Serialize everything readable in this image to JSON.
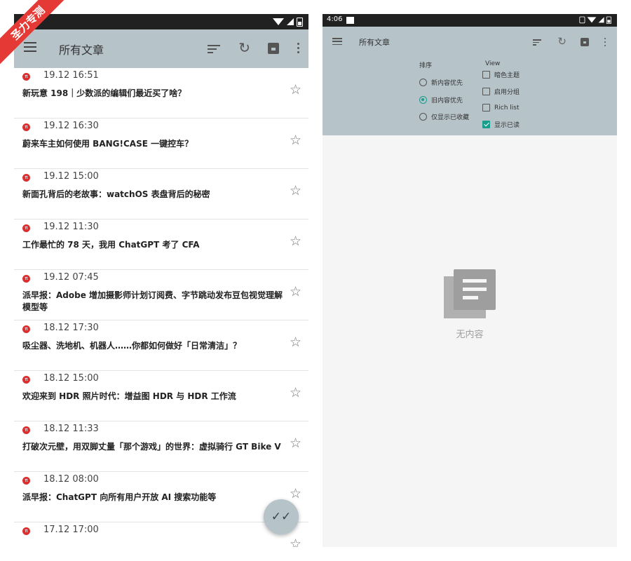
{
  "watermark": "圣力专测",
  "left": {
    "title": "所有文章",
    "articles": [
      {
        "time": "19.12 16:51",
        "title": "新玩意 198｜少数派的编辑们最近买了啥？"
      },
      {
        "time": "19.12 16:30",
        "title": "蔚来车主如何使用 BANG!CASE 一键控车？"
      },
      {
        "time": "19.12 15:00",
        "title": "新面孔背后的老故事：watchOS 表盘背后的秘密"
      },
      {
        "time": "19.12 11:30",
        "title": "工作最忙的 78 天，我用 ChatGPT 考了 CFA"
      },
      {
        "time": "19.12 07:45",
        "title": "派早报：Adobe 增加摄影师计划订阅费、字节跳动发布豆包视觉理解模型等"
      },
      {
        "time": "18.12 17:30",
        "title": "吸尘器、洗地机、机器人……你都如何做好「日常清洁」？"
      },
      {
        "time": "18.12 15:00",
        "title": "欢迎来到 HDR 照片时代：增益图 HDR 与 HDR 工作流"
      },
      {
        "time": "18.12 11:33",
        "title": "打破次元壁，用双脚丈量「那个游戏」的世界：虚拟骑行 GT Bike V"
      },
      {
        "time": "18.12 08:00",
        "title": "派早报：ChatGPT 向所有用户开放 AI 搜索功能等"
      },
      {
        "time": "17.12 17:00",
        "title": ""
      }
    ]
  },
  "right": {
    "status_time": "4:06",
    "title": "所有文章",
    "sort_header": "排序",
    "view_header": "View",
    "sort_options": [
      {
        "label": "新内容优先",
        "selected": false
      },
      {
        "label": "旧内容优先",
        "selected": true
      },
      {
        "label": "仅显示已收藏",
        "selected": false
      }
    ],
    "view_options": [
      {
        "label": "暗色主题",
        "checked": false
      },
      {
        "label": "启用分组",
        "checked": false
      },
      {
        "label": "Rich list",
        "checked": false
      },
      {
        "label": "显示已读",
        "checked": true
      }
    ],
    "empty_text": "无内容"
  },
  "colors": {
    "appbar": "#b6c3c9",
    "accent": "#1a9e8c",
    "source_icon": "#d93030"
  }
}
